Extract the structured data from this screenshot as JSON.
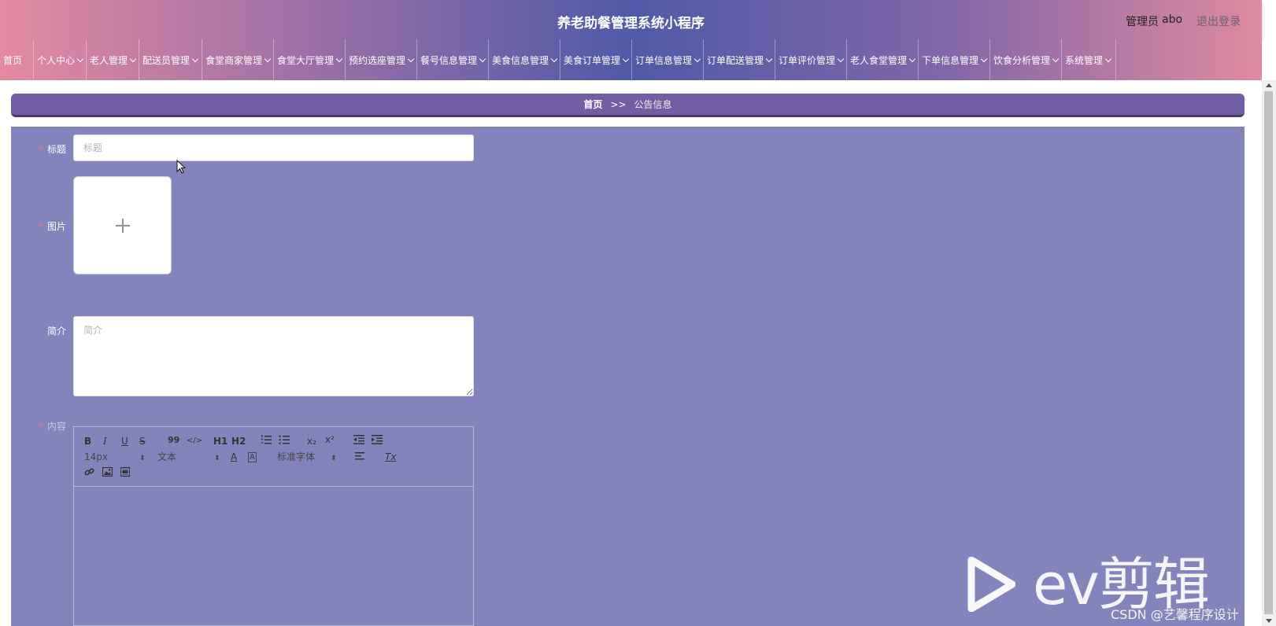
{
  "header": {
    "title": "养老助餐管理系统小程序",
    "role": "管理员",
    "username": "abo",
    "logout": "退出登录"
  },
  "nav": [
    {
      "label": "首页",
      "dropdown": false
    },
    {
      "label": "个人中心",
      "dropdown": true
    },
    {
      "label": "老人管理",
      "dropdown": true
    },
    {
      "label": "配送员管理",
      "dropdown": true
    },
    {
      "label": "食堂商家管理",
      "dropdown": true
    },
    {
      "label": "食堂大厅管理",
      "dropdown": true
    },
    {
      "label": "预约选座管理",
      "dropdown": true
    },
    {
      "label": "餐号信息管理",
      "dropdown": true
    },
    {
      "label": "美食信息管理",
      "dropdown": true
    },
    {
      "label": "美食订单管理",
      "dropdown": true
    },
    {
      "label": "订单信息管理",
      "dropdown": true
    },
    {
      "label": "订单配送管理",
      "dropdown": true
    },
    {
      "label": "订单评价管理",
      "dropdown": true
    },
    {
      "label": "老人食堂管理",
      "dropdown": true
    },
    {
      "label": "下单信息管理",
      "dropdown": true
    },
    {
      "label": "饮食分析管理",
      "dropdown": true
    },
    {
      "label": "系统管理",
      "dropdown": true
    }
  ],
  "breadcrumb": {
    "home": "首页",
    "separator": ">>",
    "current": "公告信息"
  },
  "form": {
    "title_label": "标题",
    "title_placeholder": "标题",
    "title_value": "",
    "image_label": "图片",
    "image_tip": "",
    "intro_label": "简介",
    "intro_placeholder": "简介",
    "content_label": "内容"
  },
  "editor": {
    "font_size": "14px",
    "text_type": "文本",
    "font_family": "标准字体",
    "buttons": {
      "bold": "B",
      "italic": "I",
      "underline": "U",
      "strike": "S",
      "quote": "99",
      "code": "</>",
      "h1": "H1",
      "h2": "H2",
      "sub": "x₂",
      "sup": "x²",
      "color": "A",
      "background": "A",
      "clean": "Tx"
    }
  },
  "watermark": {
    "brand": "ev剪辑",
    "csdn": "CSDN @艺馨程序设计"
  },
  "colors": {
    "panel": "#8384bc",
    "breadcrumb": "#725ea2",
    "required": "#f56c6c"
  }
}
